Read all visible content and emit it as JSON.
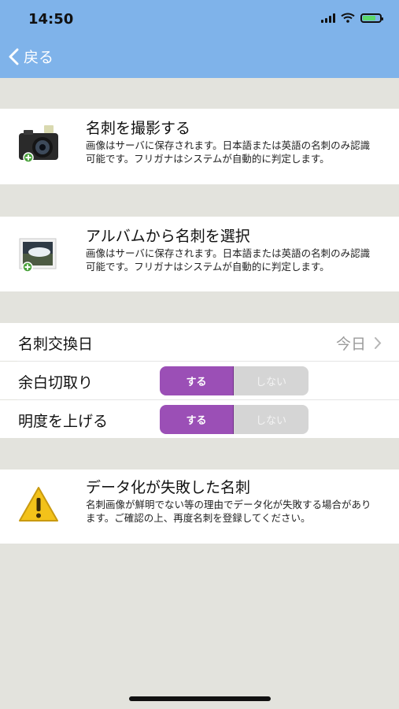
{
  "status": {
    "time": "14:50"
  },
  "nav": {
    "back_label": "戻る"
  },
  "camera_card": {
    "title": "名刺を撮影する",
    "description": "画像はサーバに保存されます。日本語または英語の名刺のみ認識可能です。フリガナはシステムが自動的に判定します。"
  },
  "album_card": {
    "title": "アルバムから名刺を選択",
    "description": "画像はサーバに保存されます。日本語または英語の名刺のみ認識可能です。フリガナはシステムが自動的に判定します。"
  },
  "settings": {
    "exchange_date": {
      "label": "名刺交換日",
      "value": "今日"
    },
    "trim": {
      "label": "余白切取り",
      "on": "する",
      "off": "しない",
      "selected": "on"
    },
    "brightness": {
      "label": "明度を上げる",
      "on": "する",
      "off": "しない",
      "selected": "on"
    }
  },
  "failed_card": {
    "title": "データ化が失敗した名刺",
    "description": "名刺画像が鮮明でない等の理由でデータ化が失敗する場合があります。ご確認の上、再度名刺を登録してください。"
  },
  "colors": {
    "header": "#7fb3ea",
    "accent": "#9b4fb6",
    "background": "#e3e3dd"
  },
  "icons": [
    "chevron-left-icon",
    "camera-icon",
    "photo-album-icon",
    "warning-icon",
    "chevron-right-icon"
  ]
}
